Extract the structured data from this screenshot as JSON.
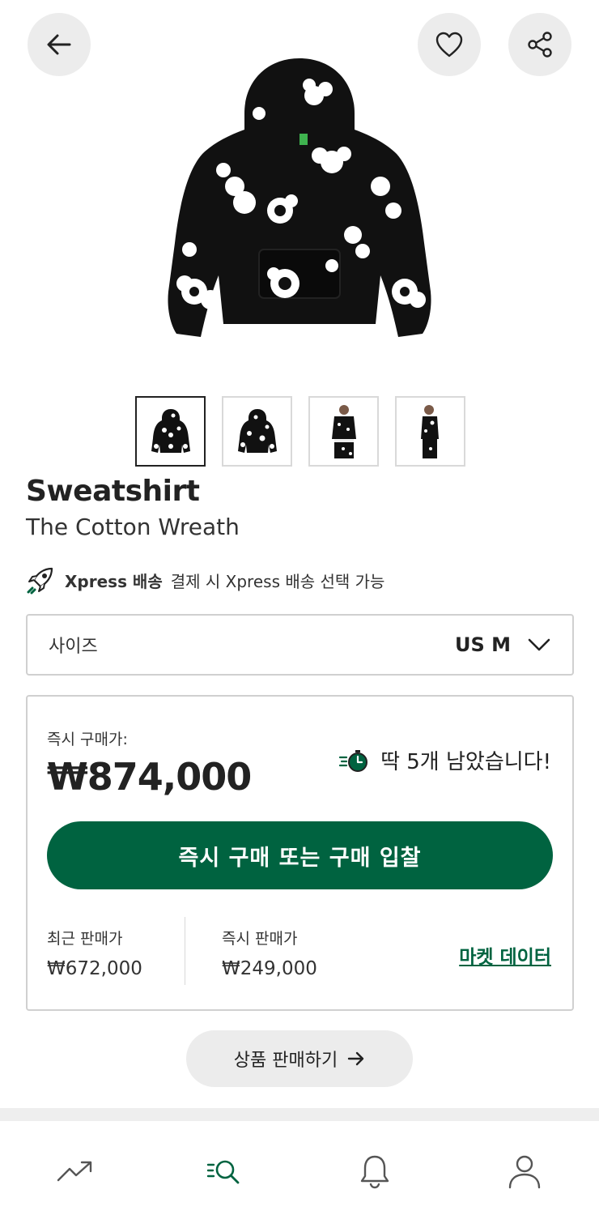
{
  "header": {
    "back_icon": "arrow-left-icon",
    "favorite_icon": "heart-icon",
    "share_icon": "share-icon"
  },
  "product": {
    "name": "Sweatshirt",
    "subtitle": "The Cotton Wreath",
    "thumbnails_count": 4,
    "selected_thumbnail": 0
  },
  "shipping": {
    "icon": "rocket-icon",
    "label": "Xpress 배송",
    "description": "결제 시 Xpress 배송 선택 가능"
  },
  "size": {
    "label": "사이즈",
    "value": "US M"
  },
  "price_card": {
    "buy_label": "즉시 구매가:",
    "buy_price": "₩874,000",
    "stock_text": "딱 5개 남았습니다!",
    "primary_button": "즉시 구매 또는 구매 입찰",
    "last_sale_label": "최근 판매가",
    "last_sale_value": "₩672,000",
    "sell_now_label": "즉시 판매가",
    "sell_now_value": "₩249,000",
    "market_link": "마켓 데이터"
  },
  "sell_button": {
    "label": "상품 판매하기"
  },
  "nav": {
    "items": [
      "trending-icon",
      "search-icon",
      "bell-icon",
      "profile-icon"
    ],
    "active_index": 1
  },
  "colors": {
    "accent": "#006340",
    "button_bg": "#ececec"
  }
}
